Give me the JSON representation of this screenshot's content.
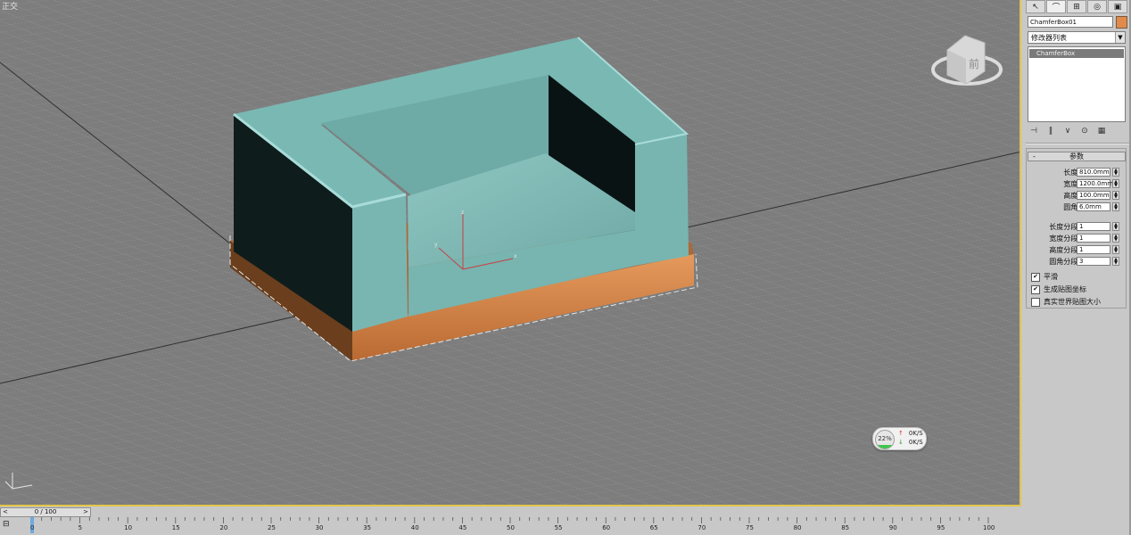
{
  "viewport": {
    "label": "正交",
    "net_widget": {
      "percent": "22%",
      "up": "0K/S",
      "down": "0K/S",
      "usage_fraction": 0.22
    }
  },
  "panel": {
    "tabs": [
      "create-tab",
      "modify-tab",
      "hierarchy-tab",
      "motion-tab",
      "display-tab",
      "utilities-tab"
    ],
    "object_name": "ChamferBox01",
    "object_color": "#e08a4e",
    "modifier_list": "修改器列表",
    "stack_items": [
      "ChamferBox"
    ],
    "rollout_title": "参数",
    "params": [
      {
        "label": "长度:",
        "value": "810.0mm"
      },
      {
        "label": "宽度:",
        "value": "1200.0mm"
      },
      {
        "label": "高度:",
        "value": "100.0mm"
      },
      {
        "label": "圆角:",
        "value": "6.0mm"
      }
    ],
    "segments": [
      {
        "label": "长度分段:",
        "value": "1"
      },
      {
        "label": "宽度分段:",
        "value": "1"
      },
      {
        "label": "高度分段:",
        "value": "1"
      },
      {
        "label": "圆角分段:",
        "value": "3"
      }
    ],
    "checks": [
      {
        "label": "平滑",
        "checked": true
      },
      {
        "label": "生成贴图坐标",
        "checked": true
      },
      {
        "label": "真实世界贴图大小",
        "checked": false
      }
    ]
  },
  "timeline": {
    "slider": "0 / 100",
    "ticks": [
      "0",
      "5",
      "10",
      "15",
      "20",
      "25",
      "30",
      "35",
      "40",
      "45",
      "50",
      "55",
      "60",
      "65",
      "70",
      "75",
      "80",
      "85",
      "90",
      "95",
      "100"
    ]
  }
}
